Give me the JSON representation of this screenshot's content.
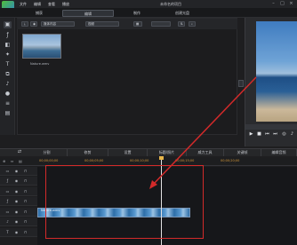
{
  "menu": {
    "items": [
      "文件",
      "编辑",
      "查看",
      "播放"
    ],
    "title": "未命名的项目"
  },
  "modes": {
    "capture": "捕获",
    "edit": "编辑",
    "produce": "制作",
    "create_disc": "创建光盘"
  },
  "library": {
    "filter_label": "媒体内容",
    "view_label": "视频",
    "clip_name": "Nature.wmv"
  },
  "timeline": {
    "tabs": [
      "分割",
      "修剪",
      "设置",
      "标题/照片",
      "威力工具",
      "关键帧",
      "编辑音频"
    ],
    "ruler_times": [
      "00;00;00;00",
      "00;00;05;00",
      "00;00;10;00",
      "00;00;15;00",
      "00;00;20;00"
    ],
    "clip_name": "Nature.wmv"
  },
  "colors": {
    "accent": "#d32a2a",
    "brand_green": "#4fbf3a",
    "brand_blue": "#2a7fd8"
  },
  "icons": [
    "app-logo-icon",
    "play-icon",
    "stop-icon",
    "prev-icon",
    "next-icon",
    "snapshot-icon",
    "volume-icon",
    "eye-icon",
    "lock-icon",
    "track-video-icon"
  ]
}
